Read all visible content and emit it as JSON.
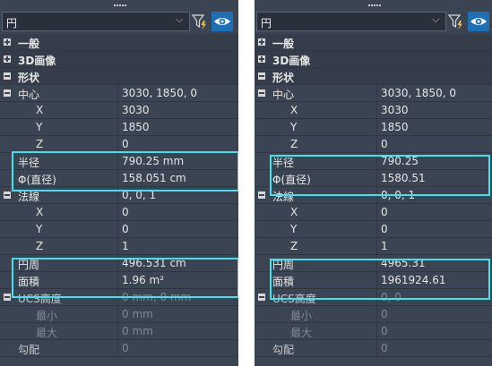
{
  "panels": [
    {
      "combo_value": "円",
      "rows": [
        {
          "name": "一般",
          "type": "category",
          "toggle": "plus"
        },
        {
          "name": "3D画像",
          "type": "category",
          "toggle": "plus"
        },
        {
          "name": "形状",
          "type": "category",
          "toggle": "minus"
        },
        {
          "name": "中心",
          "value": "3030, 1850, 0",
          "type": "group",
          "toggle": "minus"
        },
        {
          "name": "X",
          "value": "3030",
          "type": "sub"
        },
        {
          "name": "Y",
          "value": "1850",
          "type": "sub"
        },
        {
          "name": "Z",
          "value": "0",
          "type": "sub"
        },
        {
          "name": "半径",
          "value": "790.25 mm",
          "type": "prop"
        },
        {
          "name": "Φ(直径)",
          "value": "158.051 cm",
          "type": "prop"
        },
        {
          "name": "法線",
          "value": "0, 0, 1",
          "type": "group",
          "toggle": "minus"
        },
        {
          "name": "X",
          "value": "0",
          "type": "sub"
        },
        {
          "name": "Y",
          "value": "0",
          "type": "sub"
        },
        {
          "name": "Z",
          "value": "1",
          "type": "sub"
        },
        {
          "name": "円周",
          "value": "496.531 cm",
          "type": "prop"
        },
        {
          "name": "面積",
          "value": "1.96 m²",
          "type": "prop"
        },
        {
          "name": "UCS高度",
          "value": "0 mm, 0 mm",
          "type": "group",
          "toggle": "minus",
          "disabled": true
        },
        {
          "name": "最小",
          "value": "0 mm",
          "type": "sub",
          "disabled": true
        },
        {
          "name": "最大",
          "value": "0 mm",
          "type": "sub",
          "disabled": true
        },
        {
          "name": "勾配",
          "value": "0",
          "type": "prop",
          "disabled": true
        }
      ]
    },
    {
      "combo_value": "円",
      "rows": [
        {
          "name": "一般",
          "type": "category",
          "toggle": "plus"
        },
        {
          "name": "3D画像",
          "type": "category",
          "toggle": "plus"
        },
        {
          "name": "形状",
          "type": "category",
          "toggle": "minus"
        },
        {
          "name": "中心",
          "value": "3030, 1850, 0",
          "type": "group",
          "toggle": "minus"
        },
        {
          "name": "X",
          "value": "3030",
          "type": "sub"
        },
        {
          "name": "Y",
          "value": "1850",
          "type": "sub"
        },
        {
          "name": "Z",
          "value": "0",
          "type": "sub"
        },
        {
          "name": "半径",
          "value": "790.25",
          "type": "prop"
        },
        {
          "name": "Φ(直径)",
          "value": "1580.51",
          "type": "prop"
        },
        {
          "name": "法線",
          "value": "0, 0, 1",
          "type": "group",
          "toggle": "minus"
        },
        {
          "name": "X",
          "value": "0",
          "type": "sub"
        },
        {
          "name": "Y",
          "value": "0",
          "type": "sub"
        },
        {
          "name": "Z",
          "value": "1",
          "type": "sub"
        },
        {
          "name": "円周",
          "value": "4965.31",
          "type": "prop"
        },
        {
          "name": "面積",
          "value": "1961924.61",
          "type": "prop"
        },
        {
          "name": "UCS高度",
          "value": "0, 0",
          "type": "group",
          "toggle": "minus",
          "disabled": true
        },
        {
          "name": "最小",
          "value": "0",
          "type": "sub",
          "disabled": true
        },
        {
          "name": "最大",
          "value": "0",
          "type": "sub",
          "disabled": true
        },
        {
          "name": "勾配",
          "value": "0",
          "type": "prop",
          "disabled": true
        }
      ]
    }
  ],
  "icons": {
    "filter": "filter-lightning-icon",
    "eye": "eye-visibility-icon",
    "dropdown": "chevron-down-icon"
  },
  "colors": {
    "panel_bg": "#3b4453",
    "highlight": "#3fe3ee",
    "eye_button": "#1e6fb6"
  }
}
